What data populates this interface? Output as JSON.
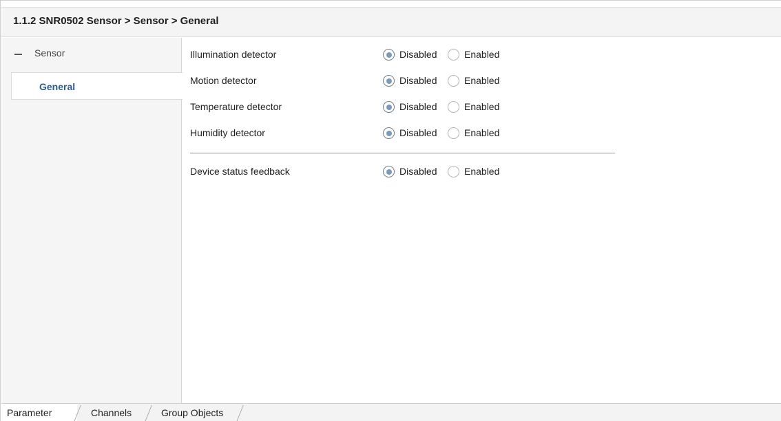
{
  "header": {
    "title": "1.1.2 SNR0502 Sensor > Sensor > General"
  },
  "sidebar": {
    "root": {
      "label": "Sensor",
      "expanded": true
    },
    "items": [
      {
        "label": "General",
        "selected": true
      }
    ]
  },
  "parameters": [
    {
      "label": "Illumination detector",
      "options": [
        "Disabled",
        "Enabled"
      ],
      "value": "Disabled"
    },
    {
      "label": "Motion detector",
      "options": [
        "Disabled",
        "Enabled"
      ],
      "value": "Disabled"
    },
    {
      "label": "Temperature detector",
      "options": [
        "Disabled",
        "Enabled"
      ],
      "value": "Disabled"
    },
    {
      "label": "Humidity detector",
      "options": [
        "Disabled",
        "Enabled"
      ],
      "value": "Disabled"
    },
    {
      "label": "Device status feedback",
      "options": [
        "Disabled",
        "Enabled"
      ],
      "value": "Disabled"
    }
  ],
  "tabs": [
    {
      "label": "Parameter",
      "active": true
    },
    {
      "label": "Channels",
      "active": false
    },
    {
      "label": "Group Objects",
      "active": false
    }
  ],
  "colors": {
    "accent_text": "#2a5a9a",
    "radio_selected": "#7a9bbe"
  }
}
